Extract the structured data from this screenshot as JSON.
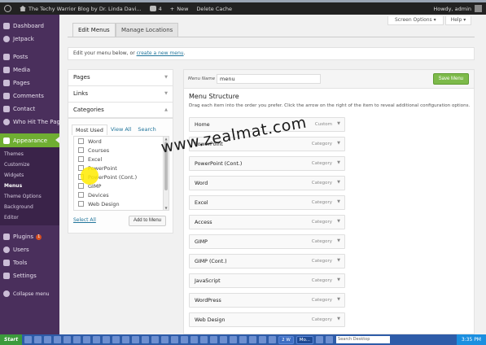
{
  "admin_bar": {
    "site_title": "The Techy Warrior Blog by Dr. Linda Davi...",
    "comments_count": "4",
    "new_label": "New",
    "delete_cache_label": "Delete Cache",
    "howdy_label": "Howdy, admin"
  },
  "sidebar": {
    "items": [
      {
        "label": "Dashboard",
        "icon": "dashboard-icon"
      },
      {
        "label": "Jetpack",
        "icon": "jetpack-icon"
      },
      {
        "label": "Posts",
        "icon": "pin-icon"
      },
      {
        "label": "Media",
        "icon": "media-icon"
      },
      {
        "label": "Pages",
        "icon": "page-icon"
      },
      {
        "label": "Comments",
        "icon": "comment-icon"
      },
      {
        "label": "Contact",
        "icon": "contact-icon"
      },
      {
        "label": "Who Hit The Page",
        "icon": "globe-icon"
      }
    ],
    "appearance": {
      "label": "Appearance",
      "icon": "brush-icon"
    },
    "appearance_sub": [
      "Themes",
      "Customize",
      "Widgets",
      "Menus",
      "Theme Options",
      "Background",
      "Editor"
    ],
    "current_sub": "Menus",
    "items_after": [
      {
        "label": "Plugins",
        "icon": "plugin-icon",
        "badge": "1"
      },
      {
        "label": "Users",
        "icon": "users-icon"
      },
      {
        "label": "Tools",
        "icon": "tools-icon"
      },
      {
        "label": "Settings",
        "icon": "settings-icon"
      }
    ],
    "collapse_label": "Collapse menu"
  },
  "header": {
    "screen_options": "Screen Options ▾",
    "help": "Help ▾",
    "tabs": [
      "Edit Menus",
      "Manage Locations"
    ]
  },
  "manage": {
    "text": "Edit your menu below, or ",
    "link": "create a new menu",
    "suffix": "."
  },
  "accordion": {
    "sections": [
      "Pages",
      "Links",
      "Categories"
    ],
    "category_tabs": [
      "Most Used",
      "View All",
      "Search"
    ],
    "categories": [
      "Word",
      "Courses",
      "Excel",
      "PowerPoint",
      "PowerPoint (Cont.)",
      "GIMP",
      "Devices",
      "Web Design"
    ],
    "select_all": "Select All",
    "add_to_menu": "Add to Menu"
  },
  "editor": {
    "menu_name_label": "Menu Name",
    "menu_name_value": "menu",
    "save_label": "Save Menu",
    "structure_title": "Menu Structure",
    "structure_desc": "Drag each item into the order you prefer. Click the arrow on the right of the item to reveal additional configuration options.",
    "items": [
      {
        "title": "Home",
        "type": "Custom"
      },
      {
        "title": "PowerPoint",
        "type": "Category"
      },
      {
        "title": "PowerPoint (Cont.)",
        "type": "Category"
      },
      {
        "title": "Word",
        "type": "Category"
      },
      {
        "title": "Excel",
        "type": "Category"
      },
      {
        "title": "Access",
        "type": "Category"
      },
      {
        "title": "GIMP",
        "type": "Category"
      },
      {
        "title": "GIMP (Cont.)",
        "type": "Category"
      },
      {
        "title": "JavaScript",
        "type": "Category"
      },
      {
        "title": "WordPress",
        "type": "Category"
      },
      {
        "title": "Web Design",
        "type": "Category"
      }
    ]
  },
  "watermark": "www.zealmat.com",
  "taskbar": {
    "start_label": "Start",
    "tasks": [
      "2 W",
      "Mo..."
    ],
    "search_placeholder": "Search Desktop",
    "clock": "3:35 PM"
  }
}
